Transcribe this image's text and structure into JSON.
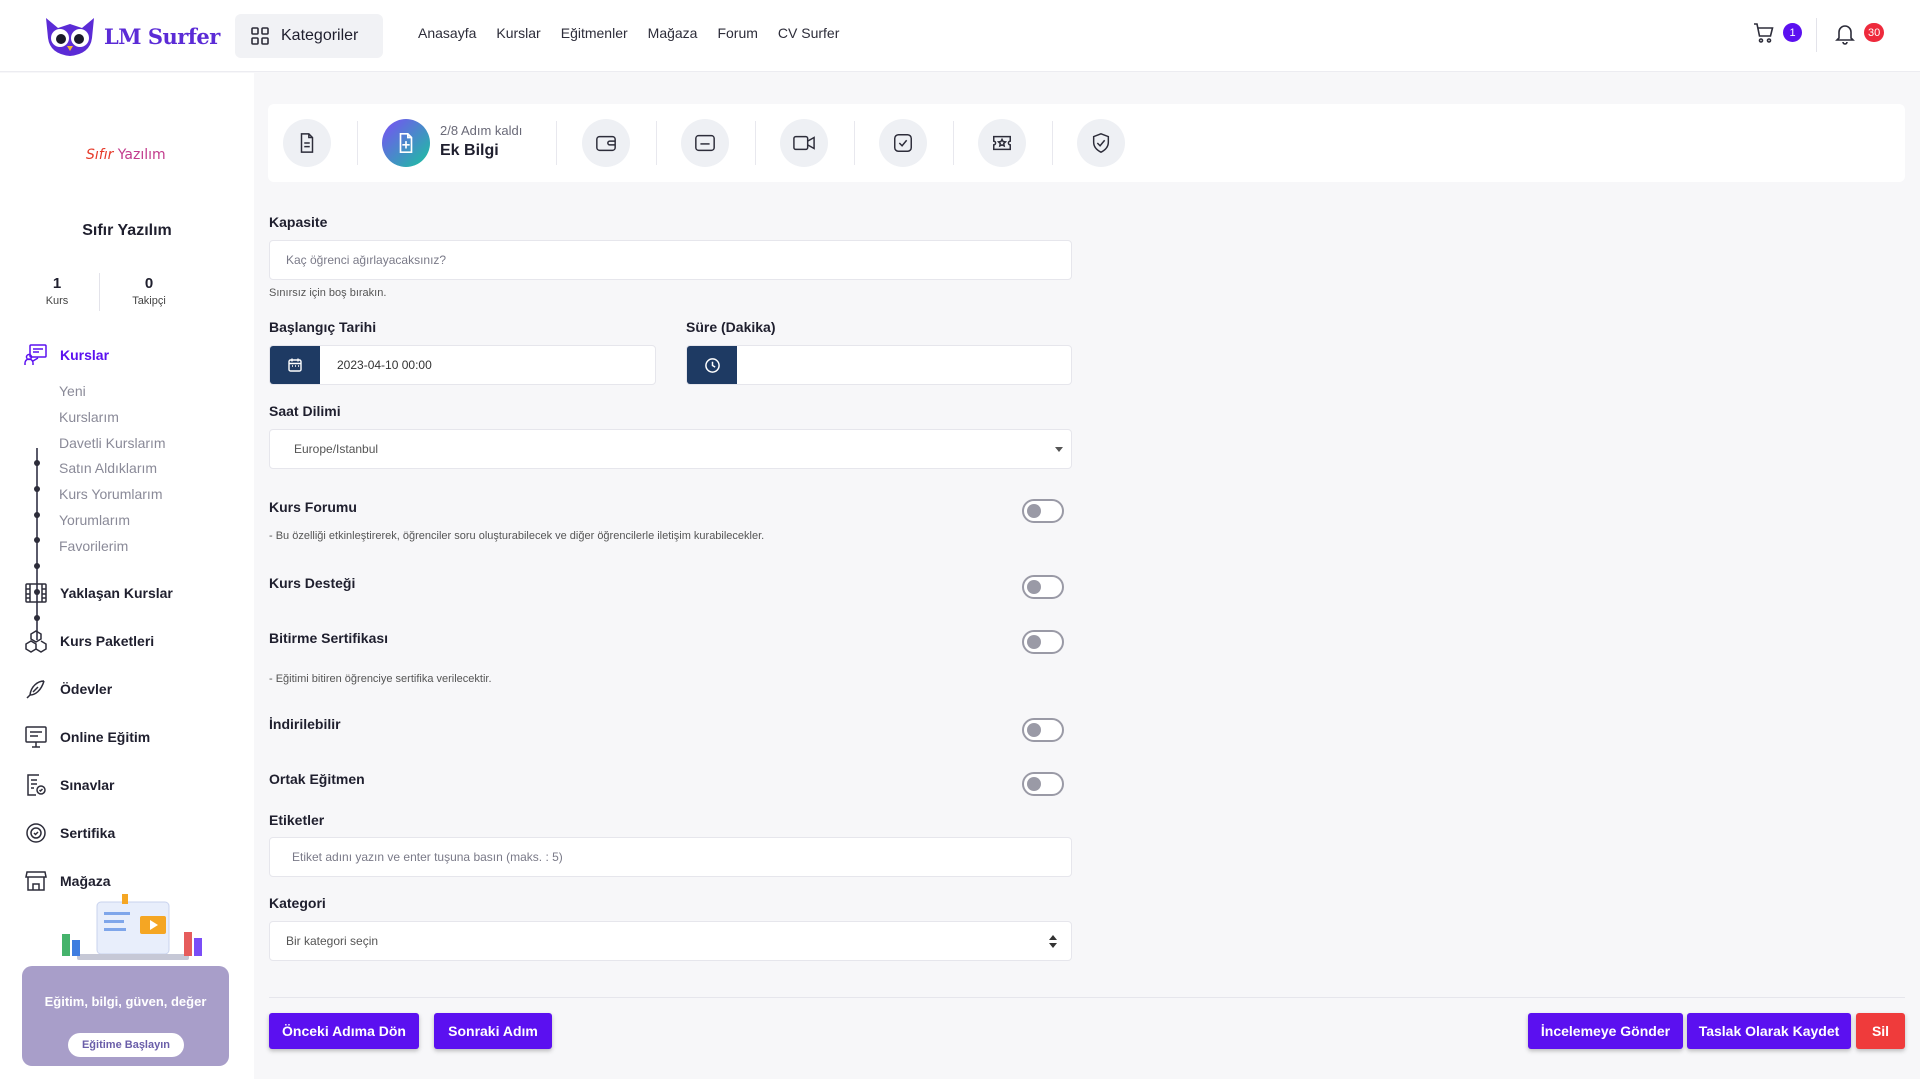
{
  "header": {
    "logo_text": "LM Surfer",
    "categories_label": "Kategoriler",
    "nav": [
      "Anasayfa",
      "Kurslar",
      "Eğitmenler",
      "Mağaza",
      "Forum",
      "CV Surfer"
    ],
    "cart_count": "1",
    "notifications_count": "30"
  },
  "sidebar": {
    "brand_logo": {
      "part1": "Sıfır",
      "part2": " Yazılım"
    },
    "org_name": "Sıfır Yazılım",
    "stats": [
      {
        "value": "1",
        "label": "Kurs"
      },
      {
        "value": "0",
        "label": "Takipçi"
      }
    ],
    "courses_label": "Kurslar",
    "sub_items": [
      "Yeni",
      "Kurslarım",
      "Davetli Kurslarım",
      "Satın Aldıklarım",
      "Kurs Yorumlarım",
      "Yorumlarım",
      "Favorilerim"
    ],
    "items": [
      "Yaklaşan Kurslar",
      "Kurs Paketleri",
      "Ödevler",
      "Online Eğitim",
      "Sınavlar",
      "Sertifika",
      "Mağaza"
    ],
    "promo": {
      "text": "Eğitim, bilgi, güven, değer",
      "button": "Eğitime Başlayın"
    }
  },
  "steps": {
    "progress_text": "2/8 Adım kaldı",
    "current_title": "Ek Bilgi",
    "icons": [
      "document-icon",
      "plus-document-icon",
      "wallet-icon",
      "folder-icon",
      "video-icon",
      "checkbox-icon",
      "ticket-icon",
      "shield-check-icon"
    ]
  },
  "form": {
    "capacity": {
      "label": "Kapasite",
      "placeholder": "Kaç öğrenci ağırlayacaksınız?",
      "hint": "Sınırsız için boş bırakın."
    },
    "start_date": {
      "label": "Başlangıç Tarihi",
      "value": "2023-04-10 00:00"
    },
    "duration": {
      "label": "Süre (Dakika)",
      "value": ""
    },
    "timezone": {
      "label": "Saat Dilimi",
      "value": "Europe/Istanbul"
    },
    "toggles": [
      {
        "label": "Kurs Forumu",
        "hint": "- Bu özelliği etkinleştirerek, öğrenciler soru oluşturabilecek ve diğer öğrencilerle iletişim kurabilecekler.",
        "on": false
      },
      {
        "label": "Kurs Desteği",
        "hint": "",
        "on": false
      },
      {
        "label": "Bitirme Sertifikası",
        "hint": "- Eğitimi bitiren öğrenciye sertifika verilecektir.",
        "on": false
      },
      {
        "label": "İndirilebilir",
        "hint": "",
        "on": false
      },
      {
        "label": "Ortak Eğitmen",
        "hint": "",
        "on": false
      }
    ],
    "tags": {
      "label": "Etiketler",
      "placeholder": "Etiket adını yazın ve enter tuşuna basın (maks. : 5)"
    },
    "category": {
      "label": "Kategori",
      "value": "Bir kategori seçin"
    }
  },
  "actions": {
    "prev": "Önceki Adıma Dön",
    "next": "Sonraki Adım",
    "review": "İncelemeye Gönder",
    "draft": "Taslak Olarak Kaydet",
    "delete": "Sil"
  },
  "colors": {
    "accent": "#5b10f0",
    "danger": "#ef3b3b",
    "addon": "#1e3a63"
  }
}
